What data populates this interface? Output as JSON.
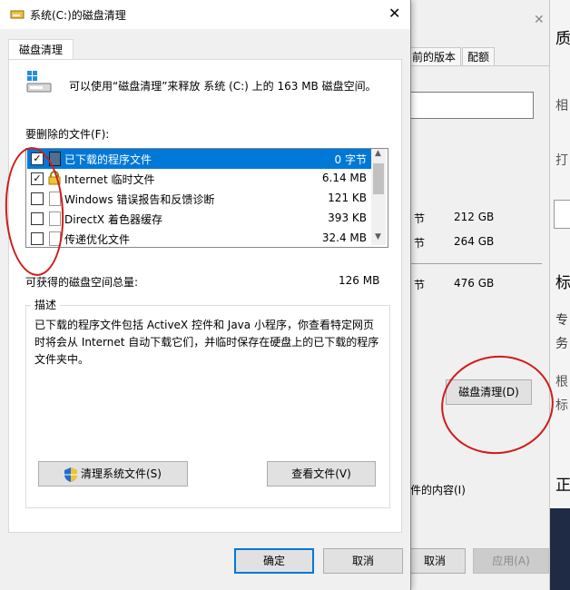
{
  "dialog": {
    "title": "系统(C:)的磁盘清理",
    "tab": "磁盘清理",
    "intro": "可以使用“磁盘清理”来释放 系统 (C:) 上的 163 MB 磁盘空间。",
    "files_label": "要删除的文件(F):",
    "files": [
      {
        "name": "已下载的程序文件",
        "size": "0 字节",
        "checked": true,
        "selected": true
      },
      {
        "name": "Internet 临时文件",
        "size": "6.14 MB",
        "checked": true,
        "selected": false
      },
      {
        "name": "Windows 错误报告和反馈诊断",
        "size": "121 KB",
        "checked": false,
        "selected": false
      },
      {
        "name": "DirectX 着色器缓存",
        "size": "393 KB",
        "checked": false,
        "selected": false
      },
      {
        "name": "传递优化文件",
        "size": "32.4 MB",
        "checked": false,
        "selected": false
      }
    ],
    "total_label": "可获得的磁盘空间总量:",
    "total_value": "126 MB",
    "desc_label": "描述",
    "desc_text": "已下载的程序文件包括 ActiveX 控件和 Java 小程序，你查看特定网页时将会从 Internet 自动下载它们，并临时保存在硬盘上的已下载的程序文件夹中。",
    "cleanup_system_btn": "清理系统文件(S)",
    "view_files_btn": "查看文件(V)",
    "ok_btn": "确定",
    "cancel_btn": "取消"
  },
  "background": {
    "tab1": "前的版本",
    "tab2": "配额",
    "rows": [
      {
        "unit": "节",
        "value": "212 GB"
      },
      {
        "unit": "节",
        "value": "264 GB"
      },
      {
        "unit": "节",
        "value": "476 GB"
      }
    ],
    "disk_cleanup_btn": "磁盘清理(D)",
    "checkbox_text": "件的内容(I)",
    "cancel_btn": "取消",
    "apply_btn": "应用(A)",
    "outer_chars": [
      "质",
      "相",
      "打",
      "标",
      "专",
      "务",
      "根",
      "标",
      "正"
    ]
  },
  "colors": {
    "accent": "#0078d7",
    "annotation": "#d11a1a"
  }
}
